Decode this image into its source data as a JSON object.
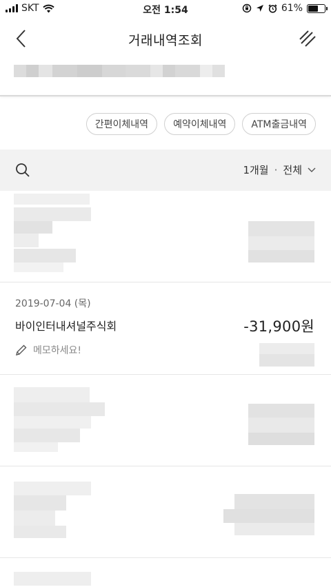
{
  "status_bar": {
    "carrier": "SKT",
    "time": "오전 1:54",
    "battery_percent": "61%",
    "battery_level": 0.61
  },
  "header": {
    "title": "거래내역조회",
    "back_icon": "chevron-left-icon",
    "menu_icon": "menu-slash-icon"
  },
  "filters": {
    "chips": [
      "간편이체내역",
      "예약이체내역",
      "ATM출금내역"
    ]
  },
  "filter_bar": {
    "period": "1개월",
    "separator": "·",
    "type": "전체"
  },
  "transactions": [
    {
      "date": "2019-07-04 (목)",
      "name": "바이인터내셔널주식회",
      "amount": "-31,900원",
      "memo_placeholder": "메모하세요!"
    }
  ],
  "colors": {
    "background": "#ffffff",
    "filter_bar_bg": "#f2f2f2",
    "text_primary": "#222222",
    "text_secondary": "#888888"
  }
}
